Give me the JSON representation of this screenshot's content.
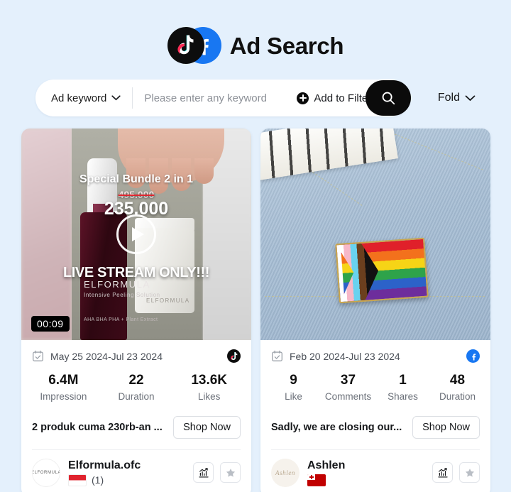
{
  "header": {
    "title": "Ad Search",
    "logos": [
      "tiktok-logo",
      "facebook-logo"
    ]
  },
  "search": {
    "keyword_type": "Ad keyword",
    "keyword_value": "",
    "placeholder": "Please enter any keyword",
    "add_filters_label": "Add to Filters",
    "search_icon": "search-icon",
    "fold_label": "Fold"
  },
  "cards": [
    {
      "platform": "tiktok",
      "media_kind": "video",
      "duration_badge": "00:09",
      "overlay": {
        "headline": "Special Bundle 2 in 1",
        "old_price": "495.000",
        "new_price": "235.000",
        "live_text": "LIVE STREAM ONLY!!!",
        "product_brand": "ELFORMULA",
        "product_desc": "Intensive Peeling Solution",
        "product_ingredients": "AHA BHA PHA + Plant Extract"
      },
      "date_range": "May 25 2024-Jul 23 2024",
      "stats": [
        {
          "value": "6.4M",
          "label": "Impression"
        },
        {
          "value": "22",
          "label": "Duration"
        },
        {
          "value": "13.6K",
          "label": "Likes"
        }
      ],
      "ad_title": "2 produk cuma 230rb-an ...",
      "cta_label": "Shop Now",
      "author": {
        "name": "Elformula.ofc",
        "avatar_text": "ELFORMULA",
        "country_flag": "indonesia",
        "count": "(1)"
      },
      "actions": [
        "analytics-icon",
        "favorite-star-icon"
      ]
    },
    {
      "platform": "facebook",
      "media_kind": "image",
      "duration_badge": "",
      "overlay": {
        "headline": "",
        "old_price": "",
        "new_price": "",
        "live_text": "",
        "product_brand": "",
        "product_desc": "",
        "product_ingredients": ""
      },
      "date_range": "Feb 20 2024-Jul 23 2024",
      "stats": [
        {
          "value": "9",
          "label": "Like"
        },
        {
          "value": "37",
          "label": "Comments"
        },
        {
          "value": "1",
          "label": "Shares"
        },
        {
          "value": "48",
          "label": "Duration"
        }
      ],
      "ad_title": "Sadly, we are closing our...",
      "cta_label": "Shop Now",
      "author": {
        "name": "Ashlen",
        "avatar_text": "Ashlen",
        "country_flag": "tonga",
        "count": ""
      },
      "actions": [
        "analytics-icon",
        "favorite-star-icon"
      ]
    }
  ],
  "colors": {
    "page_background": "#e4f0fc",
    "card_background": "#ffffff",
    "accent_dark": "#0b0b0b",
    "facebook_blue": "#1877f2",
    "text_primary": "#15171a",
    "text_secondary": "#6b7079"
  }
}
